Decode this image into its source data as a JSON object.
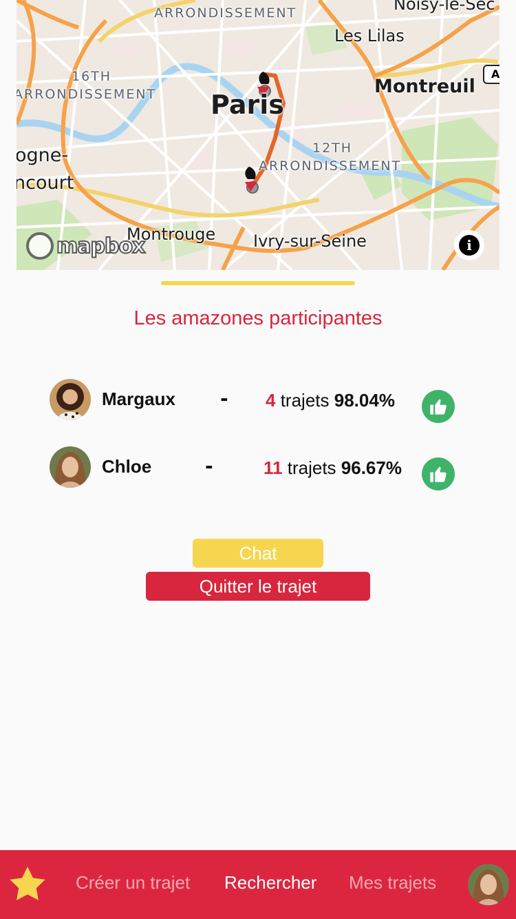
{
  "map": {
    "labels": {
      "arr_top": "ARRONDISSEMENT",
      "noisy": "Noisy-le-Sec",
      "lilas": "Les Lilas",
      "arr16_num": "16TH",
      "arr16": "ARRONDISSEMENT",
      "paris": "Paris",
      "montreuil": "Montreuil",
      "arr12_num": "12TH",
      "arr12": "ARRONDISSEMENT",
      "boulogne_1": "ogne-",
      "boulogne_2": "ncourt",
      "montrouge": "Montrouge",
      "ivry": "Ivry-sur-Seine",
      "road_badge": "A"
    },
    "attribution": "mapbox",
    "route_color": "#e0662a"
  },
  "page": {
    "title": "Les amazones participantes"
  },
  "participants": [
    {
      "name": "Margaux",
      "dash": "-",
      "trips": "4",
      "trips_label": "trajets",
      "score": "98.04%"
    },
    {
      "name": "Chloe",
      "dash": "-",
      "trips": "11",
      "trips_label": "trajets",
      "score": "96.67%"
    }
  ],
  "actions": {
    "chat": "Chat",
    "quit": "Quitter le trajet"
  },
  "nav": {
    "create": "Créer un trajet",
    "search": "Rechercher",
    "my_trips": "Mes trajets"
  },
  "colors": {
    "accent_red": "#dc2640",
    "accent_yellow": "#f7d64f",
    "thumb_green": "#3fb36b"
  },
  "icons": {
    "favorites": "star-icon",
    "rating": "thumbs-up-icon",
    "info": "info-icon"
  }
}
